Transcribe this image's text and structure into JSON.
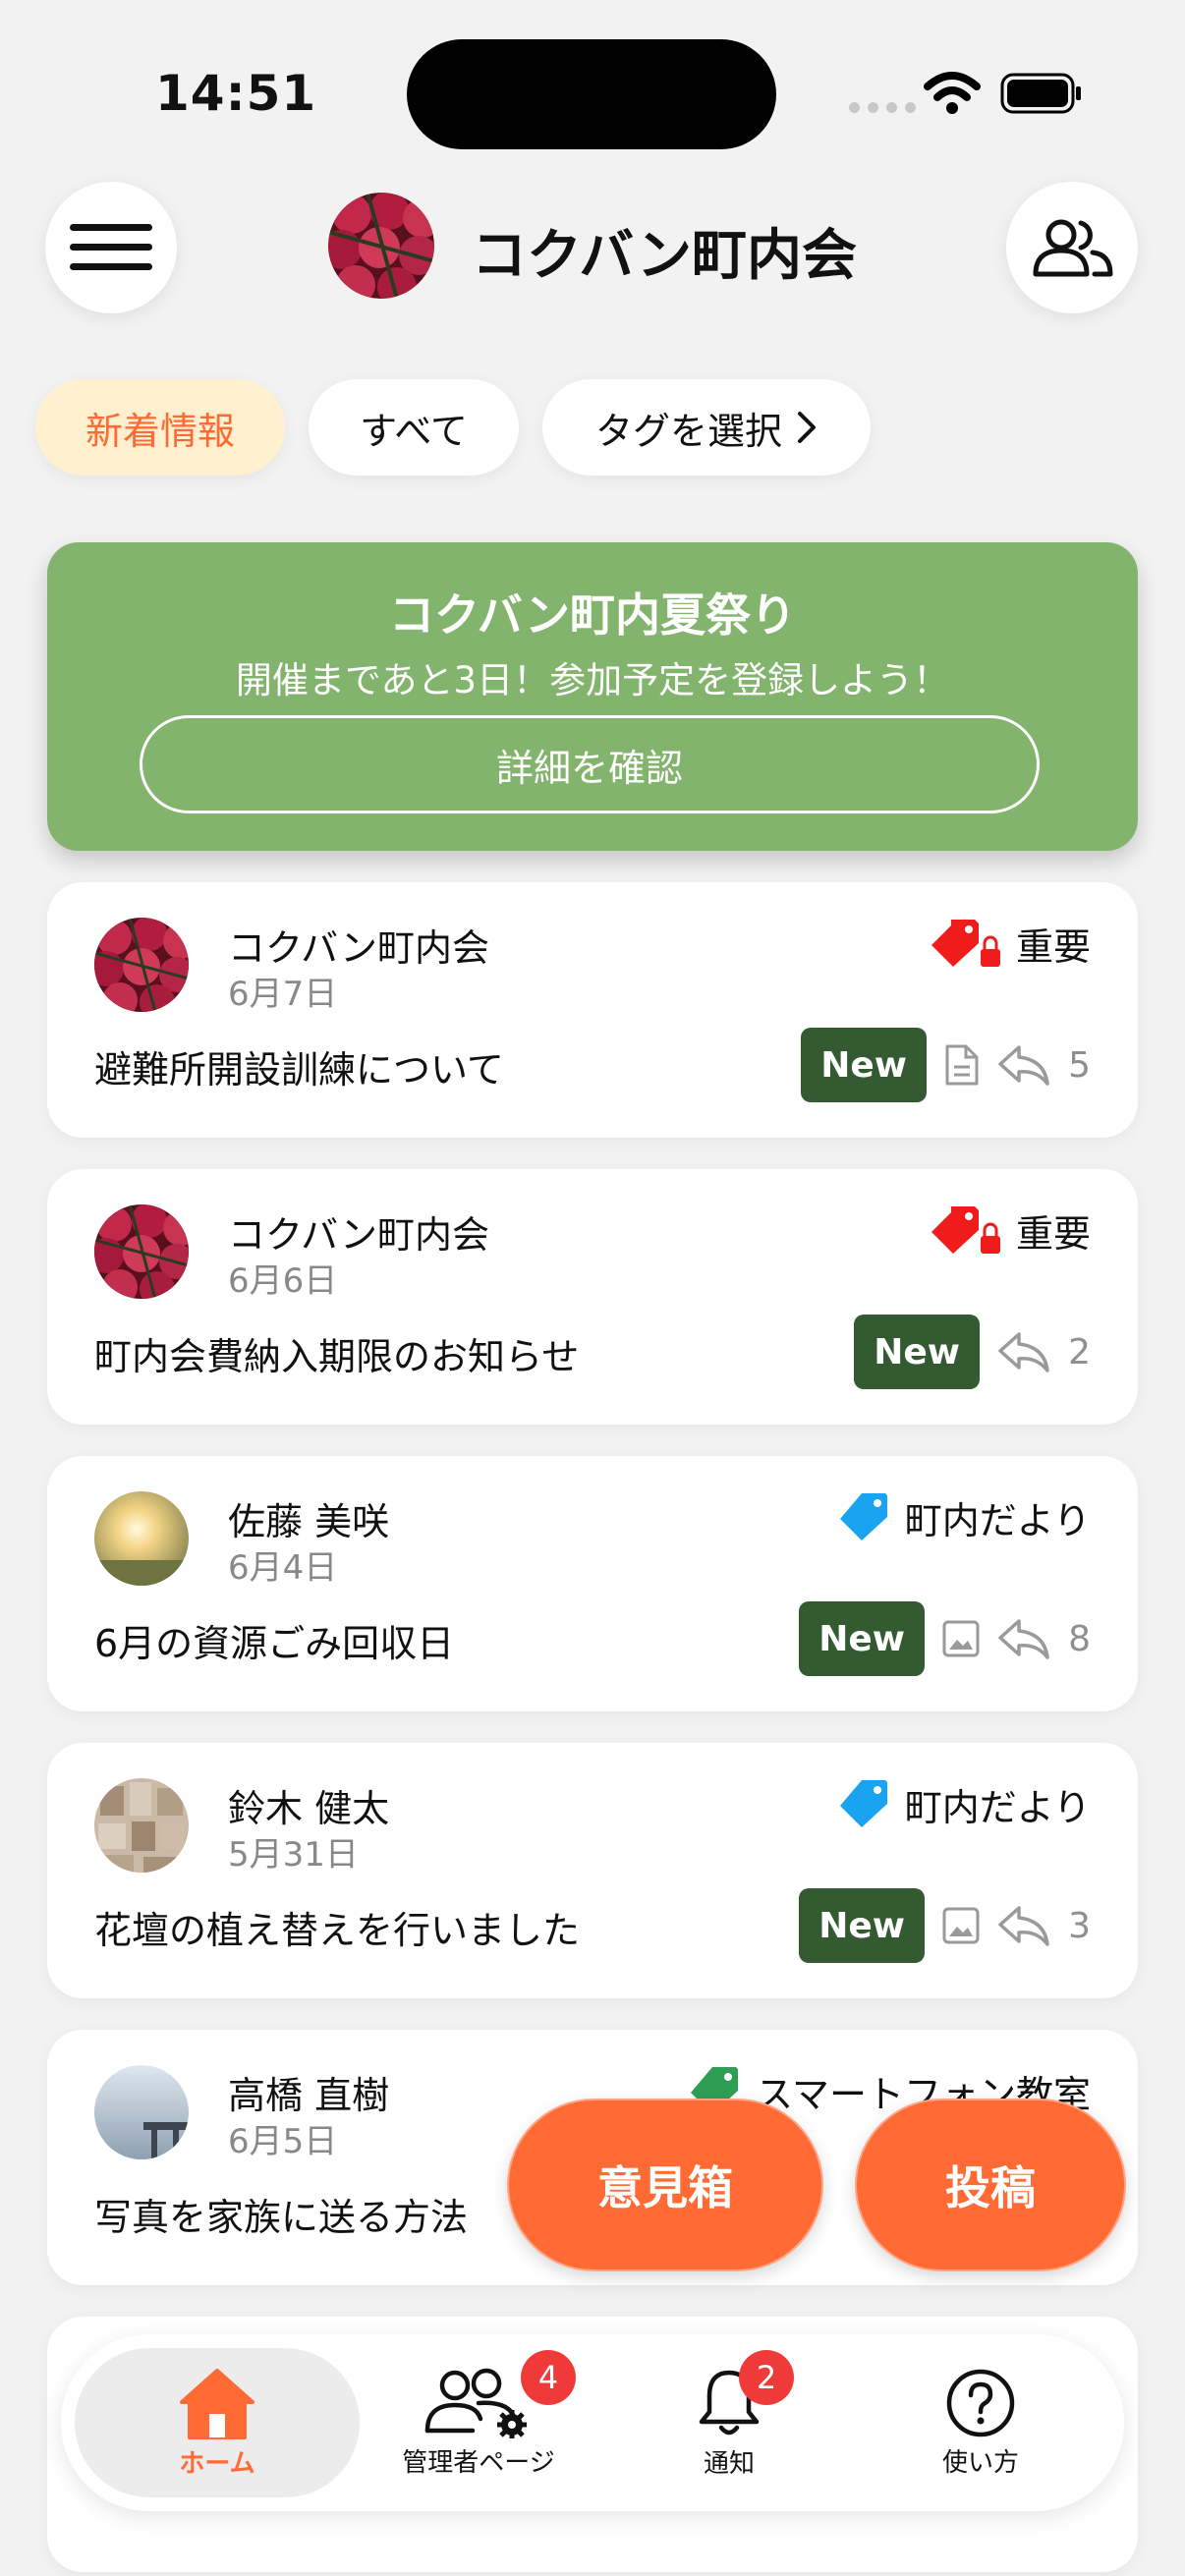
{
  "status_bar": {
    "time": "14:51"
  },
  "header": {
    "title": "コクバン町内会"
  },
  "chips": {
    "new_info": "新着情報",
    "all": "すべて",
    "select_tag": "タグを選択"
  },
  "banner": {
    "title": "コクバン町内夏祭り",
    "subtitle": "開催まであと3日！参加予定を登録しよう！",
    "button": "詳細を確認"
  },
  "posts": [
    {
      "author": "コクバン町内会",
      "date": "6月7日",
      "tag": "重要",
      "title": "避難所開設訓練について",
      "badge": "New",
      "replies": "5"
    },
    {
      "author": "コクバン町内会",
      "date": "6月6日",
      "tag": "重要",
      "title": "町内会費納入期限のお知らせ",
      "badge": "New",
      "replies": "2"
    },
    {
      "author": "佐藤 美咲",
      "date": "6月4日",
      "tag": "町内だより",
      "title": "6月の資源ごみ回収日",
      "badge": "New",
      "replies": "8"
    },
    {
      "author": "鈴木 健太",
      "date": "5月31日",
      "tag": "町内だより",
      "title": "花壇の植え替えを行いました",
      "badge": "New",
      "replies": "3"
    },
    {
      "author": "高橋 直樹",
      "date": "6月5日",
      "tag": "スマートフォン教室",
      "title": "写真を家族に送る方法"
    }
  ],
  "fab": {
    "opinion_box": "意見箱",
    "post": "投稿"
  },
  "tabbar": {
    "home": "ホーム",
    "admin": "管理者ページ",
    "admin_badge": "4",
    "notifications": "通知",
    "notifications_badge": "2",
    "help": "使い方"
  },
  "colors": {
    "accent": "#ff6a35",
    "banner_green": "#83b46d",
    "new_badge": "#345a32",
    "important_red": "#f01c1c",
    "info_blue": "#1aa3f0",
    "smartphone_green": "#2f9e55"
  }
}
